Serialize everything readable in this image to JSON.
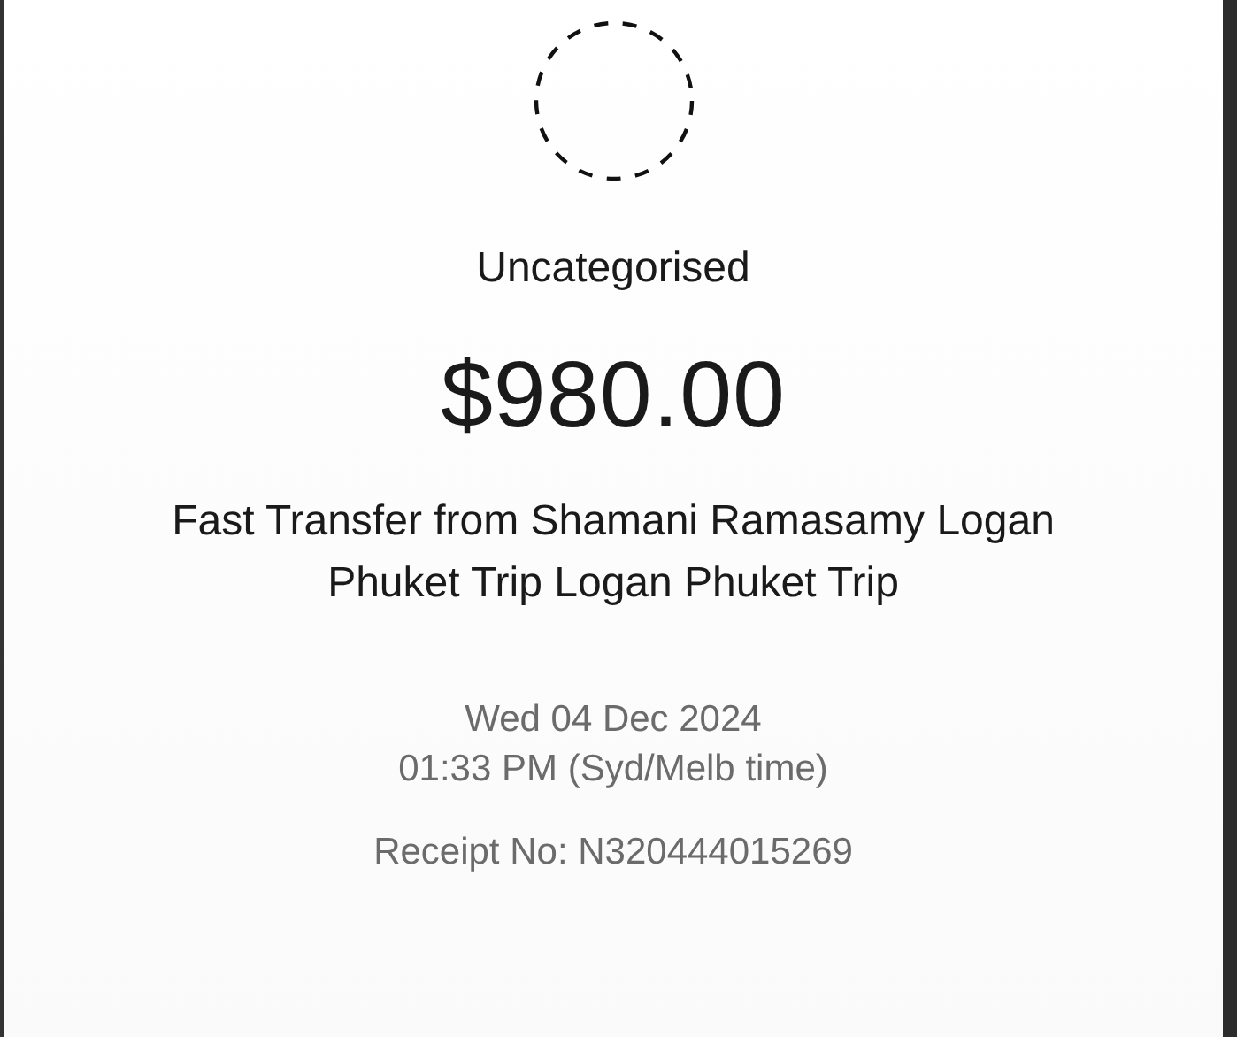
{
  "category": "Uncategorised",
  "amount": "$980.00",
  "description": "Fast Transfer from Shamani Ramasamy Logan Phuket Trip Logan Phuket Trip",
  "date": "Wed 04 Dec 2024",
  "time": "01:33 PM (Syd/Melb time)",
  "receipt": "Receipt No: N320444015269"
}
